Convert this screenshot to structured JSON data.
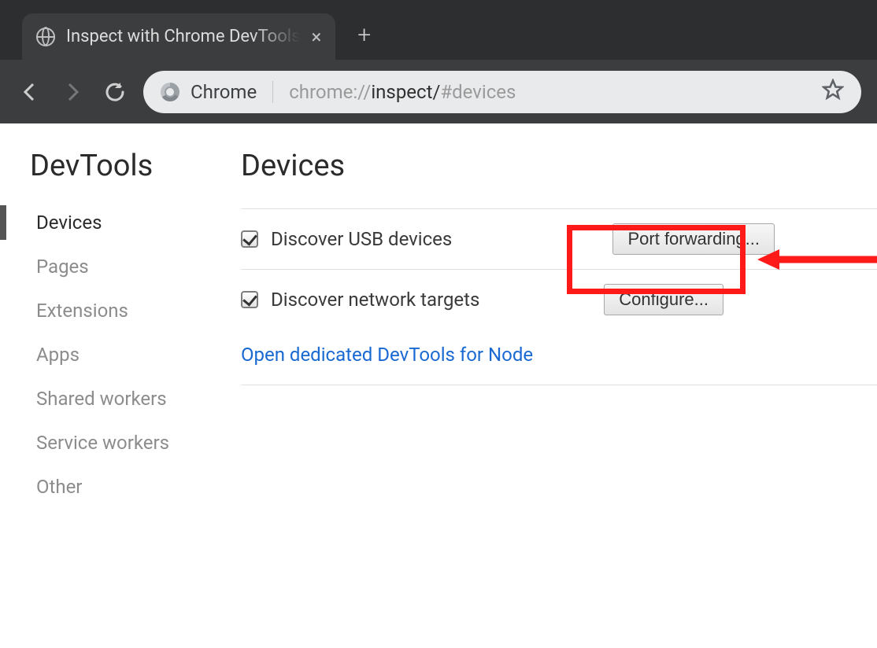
{
  "browser": {
    "tab_title": "Inspect with Chrome DevTools",
    "address_scheme_label": "Chrome",
    "url_protocol": "chrome://",
    "url_page": "inspect/",
    "url_hash": "#devices"
  },
  "sidebar": {
    "title": "DevTools",
    "items": [
      {
        "label": "Devices",
        "active": true
      },
      {
        "label": "Pages",
        "active": false
      },
      {
        "label": "Extensions",
        "active": false
      },
      {
        "label": "Apps",
        "active": false
      },
      {
        "label": "Shared workers",
        "active": false
      },
      {
        "label": "Service workers",
        "active": false
      },
      {
        "label": "Other",
        "active": false
      }
    ]
  },
  "main": {
    "heading": "Devices",
    "row_usb": {
      "checked": true,
      "label": "Discover USB devices",
      "button": "Port forwarding..."
    },
    "row_net": {
      "checked": true,
      "label": "Discover network targets",
      "button": "Configure..."
    },
    "node_link": "Open dedicated DevTools for Node"
  },
  "annotation": {
    "highlight_target": "configure-button",
    "color": "#ff1a1a"
  }
}
